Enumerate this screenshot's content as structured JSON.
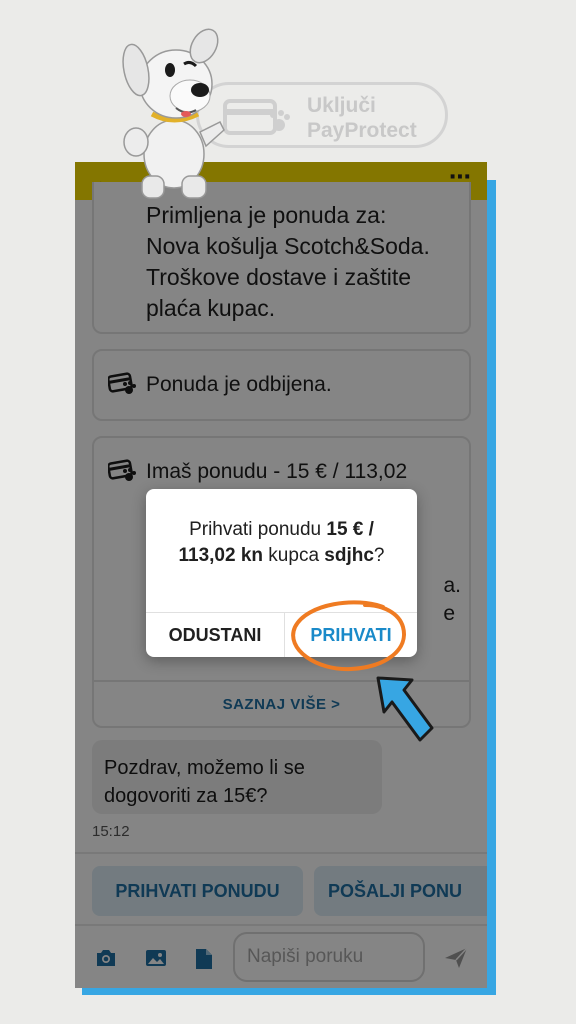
{
  "payprotect": {
    "line1": "Uključi",
    "line2": "PayProtect"
  },
  "app_bar": {
    "back_icon": "arrow-left-icon",
    "menu_icon": "more-dots-icon",
    "title": ""
  },
  "messages": {
    "offer_received": "Primljena je ponuda za:\nNova košulja Scotch&Soda.\nTroškove dostave i zaštite\nplaća kupac.",
    "offer_rejected": "Ponuda je odbijena.",
    "offer_you_have": "Imaš ponudu - 15 € / 113,02",
    "fragment_a": "a.",
    "fragment_e": "e",
    "learn_more": "SAZNAJ VIŠE >",
    "chat_bubble": "Pozdrav, možemo li se dogovoriti za 15€?",
    "timestamp": "15:12"
  },
  "quick_actions": {
    "accept_offer": "PRIHVATI PONUDU",
    "send_offer": "POŠALJI PONU"
  },
  "composer": {
    "placeholder": "Napiši poruku",
    "icons": [
      "camera-icon",
      "image-icon",
      "file-icon",
      "send-icon"
    ]
  },
  "dialog": {
    "prefix": "Prihvati ponudu ",
    "amount": "15 € / 113,02 kn",
    "middle": " kupca ",
    "buyer": "sdjhc",
    "suffix": "?",
    "cancel": "ODUSTANI",
    "accept": "PRIHVATI"
  },
  "colors": {
    "accent_blue": "#37a6e3",
    "app_bar_yellow": "#fde300",
    "annotation_orange": "#ef7b22",
    "button_text_blue": "#1a8ac9"
  }
}
